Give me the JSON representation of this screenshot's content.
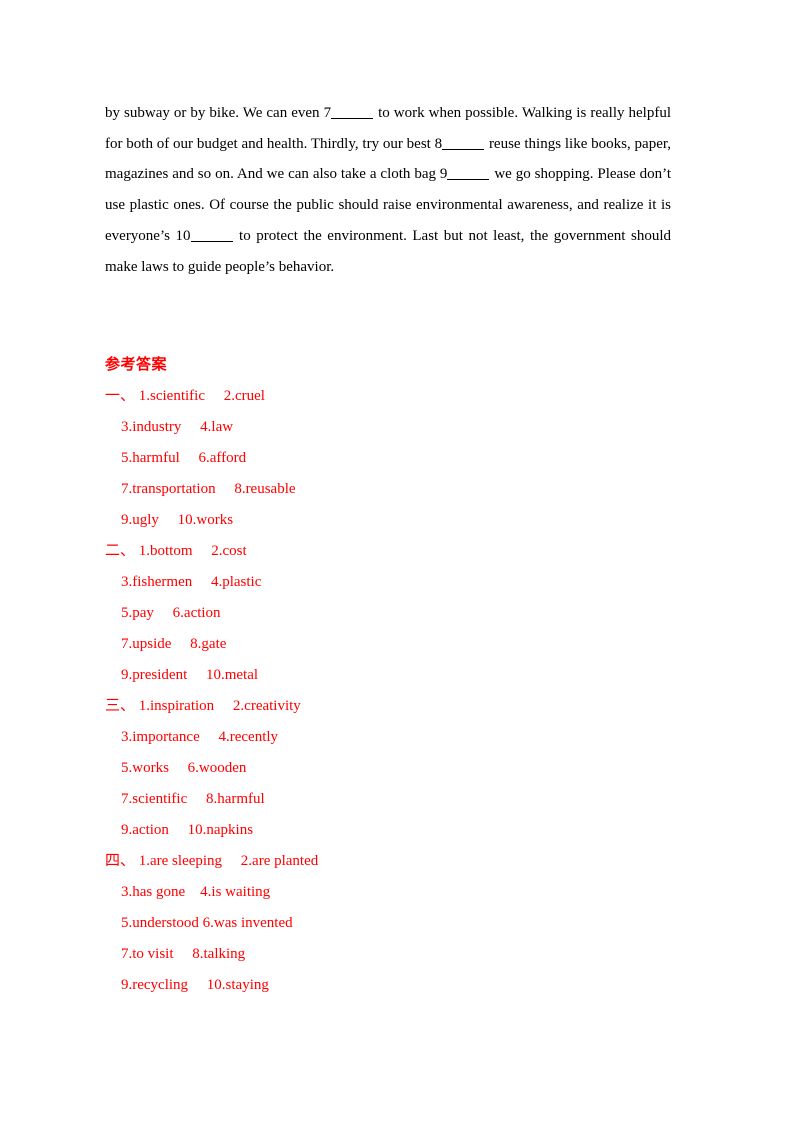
{
  "passage": {
    "segments": [
      {
        "type": "text",
        "value": "by subway or by bike. We can even 7"
      },
      {
        "type": "blank"
      },
      {
        "type": "text",
        "value": " to work when possible. Walking is really helpful for both of our budget and health. Thirdly, try our best 8"
      },
      {
        "type": "blank"
      },
      {
        "type": "text",
        "value": " reuse things like books, paper, magazines and so on. And we can also take a cloth bag 9"
      },
      {
        "type": "blank"
      },
      {
        "type": "text",
        "value": " we go shopping. Please don’t use plastic ones. Of course the public should raise environmental awareness, and realize it is everyone’s 10"
      },
      {
        "type": "blank"
      },
      {
        "type": "text",
        "value": " to protect the environment. Last but not least, the government should make laws to guide people’s behavior."
      }
    ],
    "full_text": "by subway or by bike. We can even 7_____ to work when possible. Walking is really helpful for both of our budget and health. Thirdly, try our best 8_____ reuse things like books, paper, magazines and so on. And we can also take a cloth bag 9_____ we go shopping. Please don’t use plastic ones. Of course the public should raise environmental awareness, and realize it is everyone’s 10_____ to protect the environment. Last but not least, the government should make laws to guide people’s behavior."
  },
  "answer_key": {
    "title": "参考答案",
    "color": "#ff0000",
    "sections": [
      {
        "marker": "一、",
        "lines": [
          "一、 1.scientific     2.cruel",
          "3.industry     4.law",
          "5.harmful     6.afford",
          "7.transportation     8.reusable",
          "9.ugly     10.works"
        ],
        "items": [
          {
            "num": "1",
            "answer": "scientific"
          },
          {
            "num": "2",
            "answer": "cruel"
          },
          {
            "num": "3",
            "answer": "industry"
          },
          {
            "num": "4",
            "answer": "law"
          },
          {
            "num": "5",
            "answer": "harmful"
          },
          {
            "num": "6",
            "answer": "afford"
          },
          {
            "num": "7",
            "answer": "transportation"
          },
          {
            "num": "8",
            "answer": "reusable"
          },
          {
            "num": "9",
            "answer": "ugly"
          },
          {
            "num": "10",
            "answer": "works"
          }
        ]
      },
      {
        "marker": "二、",
        "lines": [
          "二、 1.bottom     2.cost",
          "3.fishermen     4.plastic",
          "5.pay     6.action",
          "7.upside     8.gate",
          "9.president     10.metal"
        ],
        "items": [
          {
            "num": "1",
            "answer": "bottom"
          },
          {
            "num": "2",
            "answer": "cost"
          },
          {
            "num": "3",
            "answer": "fishermen"
          },
          {
            "num": "4",
            "answer": "plastic"
          },
          {
            "num": "5",
            "answer": "pay"
          },
          {
            "num": "6",
            "answer": "action"
          },
          {
            "num": "7",
            "answer": "upside"
          },
          {
            "num": "8",
            "answer": "gate"
          },
          {
            "num": "9",
            "answer": "president"
          },
          {
            "num": "10",
            "answer": "metal"
          }
        ]
      },
      {
        "marker": "三、",
        "lines": [
          "三、 1.inspiration     2.creativity",
          "3.importance     4.recently",
          "5.works     6.wooden",
          "7.scientific     8.harmful",
          "9.action     10.napkins"
        ],
        "items": [
          {
            "num": "1",
            "answer": "inspiration"
          },
          {
            "num": "2",
            "answer": "creativity"
          },
          {
            "num": "3",
            "answer": "importance"
          },
          {
            "num": "4",
            "answer": "recently"
          },
          {
            "num": "5",
            "answer": "works"
          },
          {
            "num": "6",
            "answer": "wooden"
          },
          {
            "num": "7",
            "answer": "scientific"
          },
          {
            "num": "8",
            "answer": "harmful"
          },
          {
            "num": "9",
            "answer": "action"
          },
          {
            "num": "10",
            "answer": "napkins"
          }
        ]
      },
      {
        "marker": "四、",
        "lines": [
          "四、 1.are sleeping     2.are planted",
          "3.has gone    4.is waiting",
          "5.understood 6.was invented",
          "7.to visit     8.talking",
          "9.recycling     10.staying"
        ],
        "items": [
          {
            "num": "1",
            "answer": "are sleeping"
          },
          {
            "num": "2",
            "answer": "are planted"
          },
          {
            "num": "3",
            "answer": "has gone"
          },
          {
            "num": "4",
            "answer": "is waiting"
          },
          {
            "num": "5",
            "answer": "understood"
          },
          {
            "num": "6",
            "answer": "was invented"
          },
          {
            "num": "7",
            "answer": "to visit"
          },
          {
            "num": "8",
            "answer": "talking"
          },
          {
            "num": "9",
            "answer": "recycling"
          },
          {
            "num": "10",
            "answer": "staying"
          }
        ]
      }
    ]
  }
}
